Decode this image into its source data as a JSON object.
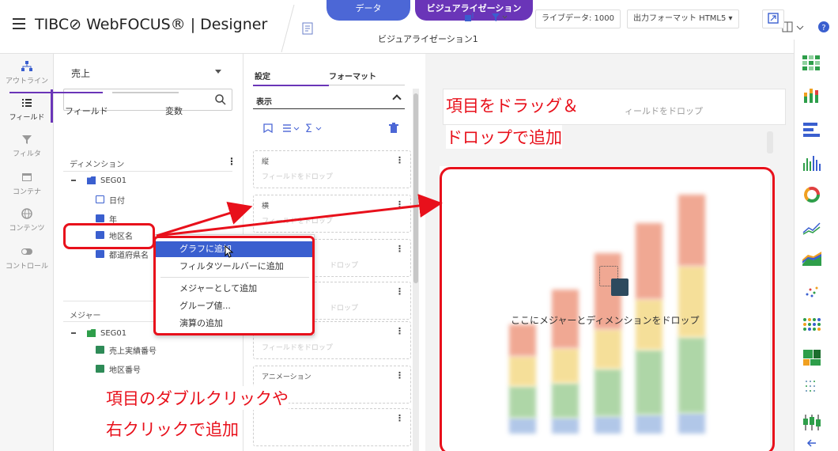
{
  "header": {
    "menu_icon": "hamburger-icon",
    "app_title": "TIBC⊘ WebFOCUS® | Designer",
    "tab_data": "データ",
    "tab_visualization": "ビジュアライゼーション",
    "visualization_name": "ビジュアライゼーション1"
  },
  "sidebar": {
    "items": [
      {
        "label": "アウトライン",
        "icon": "outline-icon"
      },
      {
        "label": "フィールド",
        "icon": "fields-icon"
      },
      {
        "label": "フィルタ",
        "icon": "filter-icon"
      },
      {
        "label": "コンテナ",
        "icon": "container-icon"
      },
      {
        "label": "コンテンツ",
        "icon": "content-icon"
      },
      {
        "label": "コントロール",
        "icon": "control-icon"
      }
    ]
  },
  "data_panel": {
    "datasource": "売上",
    "search_placeholder": "",
    "tab_fields": "フィールド",
    "tab_variables": "変数",
    "dimensions_title": "ディメンション",
    "dimension_folder": "SEG01",
    "dimensions": [
      "日付",
      "年",
      "地区名",
      "都道府県名"
    ],
    "measures_title": "メジャー",
    "measure_folder": "SEG01",
    "measures": [
      "売上実績番号",
      "地区番号"
    ]
  },
  "context_menu": {
    "items": [
      "グラフに追加",
      "フィルタツールバーに追加",
      "メジャーとして追加",
      "グループ値...",
      "演算の追加"
    ]
  },
  "buckets_panel": {
    "tab_settings": "設定",
    "tab_format": "フォーマット",
    "section": "表示",
    "buckets": [
      {
        "name": "縦",
        "drop": "フィールドをドロップ"
      },
      {
        "name": "横",
        "drop": "フィールドをドロップ"
      },
      {
        "name": "",
        "drop": "ドロップ"
      },
      {
        "name": "",
        "drop": "ドロップ"
      },
      {
        "name": "",
        "drop": "フィールドをドロップ"
      },
      {
        "name": "アニメーション",
        "drop": ""
      },
      {
        "name": "",
        "drop": ""
      }
    ]
  },
  "toolbar": {
    "live_data": "ライブデータ: 1000",
    "output_format": "出力フォーマット HTML5"
  },
  "canvas": {
    "drop_fields": "ィールドをドロップ",
    "drop_hint": "ここにメジャーとディメンションをドロップ"
  },
  "annotations": {
    "drag_drop_line1": "項目をドラッグ＆",
    "drag_drop_line2": "ドロップで追加",
    "dblclick_line1": "項目のダブルクリックや",
    "dblclick_line2": "右クリックで追加"
  },
  "chart_types": [
    "heatmap-icon",
    "stacked-bar-icon",
    "horizontal-bar-icon",
    "vertical-bar-icon",
    "donut-icon",
    "line-icon",
    "area-icon",
    "scatter-icon",
    "bubble-matrix-icon",
    "treemap-icon",
    "dot-grid-icon",
    "boxplot-icon",
    "arrow-left-icon"
  ],
  "colors": {
    "accent": "#6a35b8",
    "data_tab": "#4c67d6",
    "highlight": "#3a5fcf",
    "annotation": "#e8101b"
  }
}
